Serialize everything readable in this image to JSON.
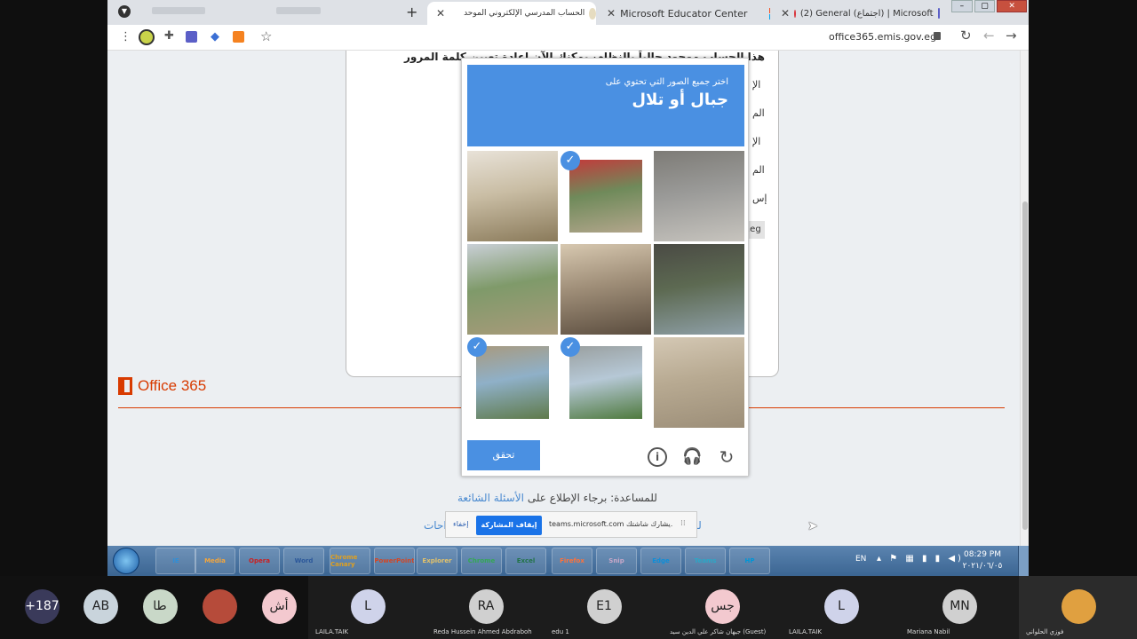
{
  "browser": {
    "tabs": [
      {
        "title": "الحساب المدرسي الإلكتروني الموحد"
      },
      {
        "title": "Microsoft Educator Center"
      },
      {
        "title": "(2) General (اجتماع) | Microsoft"
      }
    ],
    "url": "office365.emis.gov.eg"
  },
  "page": {
    "heading_fragment": "هذا الحساب موجود حالياً بالنظام، يمكنك الآن إعادة تعيين كلمة المرور",
    "side_labels": [
      "الإ",
      "الم",
      "الإ",
      "الم",
      "إس"
    ],
    "side_suffix": ".eg",
    "brand": "Office 365",
    "help_prefix": "للمساعدة: برجاء الإطلاع على",
    "help_link": "الأسئلة الشائعة",
    "lower_left": "احات",
    "lower_right": "لل"
  },
  "captcha": {
    "instruction": "اختر جميع الصور التي تحتوي على",
    "target": "جبال أو تلال",
    "verify_label": "تحقق",
    "check_mark": "✓",
    "tiles": [
      {
        "selected": false,
        "colors": [
          "#c9bda4",
          "#8a7a5a",
          "#e8e2d8"
        ]
      },
      {
        "selected": true,
        "colors": [
          "#6f8a5a",
          "#b3a68c",
          "#c23b3b"
        ]
      },
      {
        "selected": false,
        "colors": [
          "#9a9a98",
          "#c7c4be",
          "#7d7b76"
        ]
      },
      {
        "selected": false,
        "colors": [
          "#7f9a6a",
          "#a89a7a",
          "#c9cfd6"
        ]
      },
      {
        "selected": false,
        "colors": [
          "#9f8e78",
          "#5a4c3e",
          "#d7c8b0"
        ]
      },
      {
        "selected": false,
        "colors": [
          "#5d6a52",
          "#8fa0a8",
          "#4a4a44"
        ]
      },
      {
        "selected": true,
        "colors": [
          "#8fb0c8",
          "#5f7a4a",
          "#a89a80"
        ]
      },
      {
        "selected": true,
        "colors": [
          "#b6c8d6",
          "#4f7a3e",
          "#9aa0a0"
        ]
      },
      {
        "selected": false,
        "colors": [
          "#b8aa92",
          "#9c8e78",
          "#d4c8b4"
        ]
      }
    ]
  },
  "sharing_bar": {
    "text": "teams.microsoft.com يشارك شاشتك.",
    "stop_label": "إيقاف المشاركة",
    "hide_label": "إخفاء"
  },
  "taskbar": {
    "lang": "EN",
    "time": "08:29 PM",
    "date": "٢٠٢١/٠٦/٠٥",
    "apps": [
      "IE",
      "Media",
      "Opera",
      "Word",
      "Chrome Canary",
      "PowerPoint",
      "Explorer",
      "Chrome",
      "Excel",
      "Firefox",
      "Snip",
      "Edge",
      "Teams",
      "HP"
    ]
  },
  "participants": [
    {
      "initials": "+187",
      "name": ""
    },
    {
      "initials": "AB",
      "name": ""
    },
    {
      "initials": "طا",
      "name": ""
    },
    {
      "initials": "",
      "name": ""
    },
    {
      "initials": "أش",
      "name": ""
    },
    {
      "initials": "L",
      "name": "LAILA.TAIK"
    },
    {
      "initials": "RA",
      "name": "Reda Hussein Ahmed Abdraboh"
    },
    {
      "initials": "E1",
      "name": "edu 1"
    },
    {
      "initials": "جس",
      "name": "جيهان شاكر علي الدين سيد (Guest)"
    },
    {
      "initials": "L",
      "name": "LAILA.TAIK"
    },
    {
      "initials": "MN",
      "name": "Mariana Nabil"
    },
    {
      "initials": "",
      "name": "فوزي الحلواني"
    }
  ],
  "colors": {
    "accent": "#4a90e2",
    "office_orange": "#d83b01",
    "tab_strip": "#dee1e6"
  }
}
